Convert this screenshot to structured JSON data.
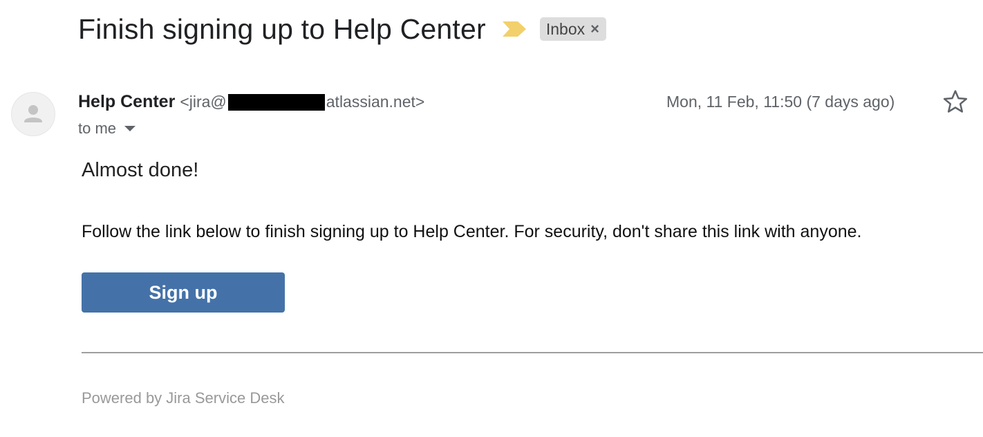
{
  "email": {
    "subject": "Finish signing up to Help Center",
    "label": {
      "name": "Inbox",
      "remove_symbol": "×"
    },
    "sender": {
      "name": "Help Center",
      "email_prefix": "<jira@",
      "email_suffix": "atlassian.net>"
    },
    "date": "Mon, 11 Feb, 11:50 (7 days ago)",
    "recipient": "to me",
    "body": {
      "heading": "Almost done!",
      "text": "Follow the link below to finish signing up to Help Center. For security, don't share this link with anyone.",
      "button_label": "Sign up",
      "footer": "Powered by Jira Service Desk"
    }
  },
  "icons": {
    "importance": "importance-marker-icon",
    "avatar": "default-avatar-icon",
    "star": "star-outline-icon",
    "caret": "caret-down-icon"
  },
  "colors": {
    "importance": "#f2d06b",
    "button": "#4472a8",
    "label_chip": "#dddddd",
    "footer_text": "#999999"
  }
}
